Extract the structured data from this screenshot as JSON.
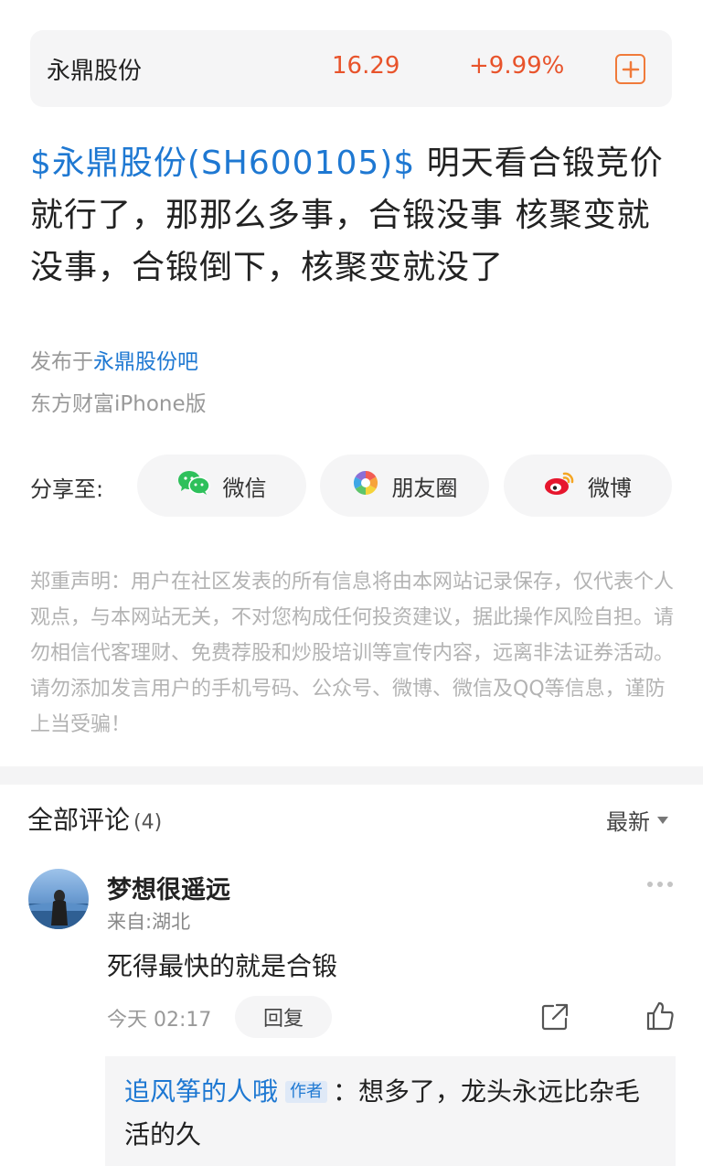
{
  "stock": {
    "name": "永鼎股份",
    "price": "16.29",
    "change": "+9.99%",
    "accent_color": "#e8532b",
    "add_icon": "plus-square-icon"
  },
  "post": {
    "tag": "$永鼎股份(SH600105)$",
    "text": " 明天看合锻竞价就行了，那那么多事，合锻没事 核聚变就没事，合锻倒下，核聚变就没了",
    "published_prefix": "发布于",
    "published_bar": "永鼎股份吧",
    "client": "东方财富iPhone版",
    "link_color": "#1e78d2"
  },
  "share": {
    "label": "分享至:",
    "wechat": "微信",
    "moments": "朋友圈",
    "weibo": "微博"
  },
  "disclaimer": "郑重声明：用户在社区发表的所有信息将由本网站记录保存，仅代表个人观点，与本网站无关，不对您构成任何投资建议，据此操作风险自担。请勿相信代客理财、免费荐股和炒股培训等宣传内容，远离非法证券活动。请勿添加发言用户的手机号码、公众号、微博、微信及QQ等信息，谨防上当受骗！",
  "comments": {
    "title": "全部评论",
    "count": "(4)",
    "sort": "最新",
    "items": [
      {
        "author": "梦想很遥远",
        "location": "来自:湖北",
        "text": "死得最快的就是合锻",
        "time": "今天 02:17",
        "reply_label": "回复",
        "replies": [
          {
            "author": "追风筝的人哦",
            "badge": "作者",
            "text": "：想多了，龙头永远比杂毛活的久"
          }
        ]
      }
    ]
  }
}
